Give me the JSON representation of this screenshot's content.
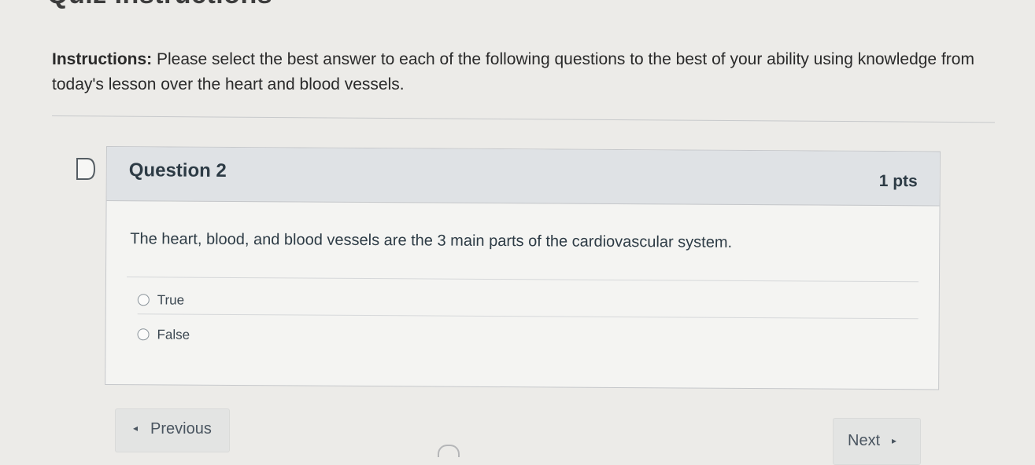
{
  "page_heading": "Quiz Instructions",
  "instructions": {
    "label": "Instructions:",
    "text": " Please select the best answer to each of the following questions to the best of your ability using knowledge from today's lesson over the heart and blood vessels."
  },
  "question": {
    "title": "Question 2",
    "points": "1 pts",
    "text": "The heart, blood, and blood vessels are the 3 main parts of the cardiovascular system.",
    "answers": [
      {
        "label": "True",
        "selected": false
      },
      {
        "label": "False",
        "selected": false
      }
    ]
  },
  "navigation": {
    "previous_label": "Previous",
    "previous_arrow": "◂",
    "next_label": "Next",
    "next_arrow": "▸"
  },
  "colors": {
    "page_background": "#ecebe8",
    "question_header": "#dfe2e5",
    "text": "#2d3b45"
  }
}
